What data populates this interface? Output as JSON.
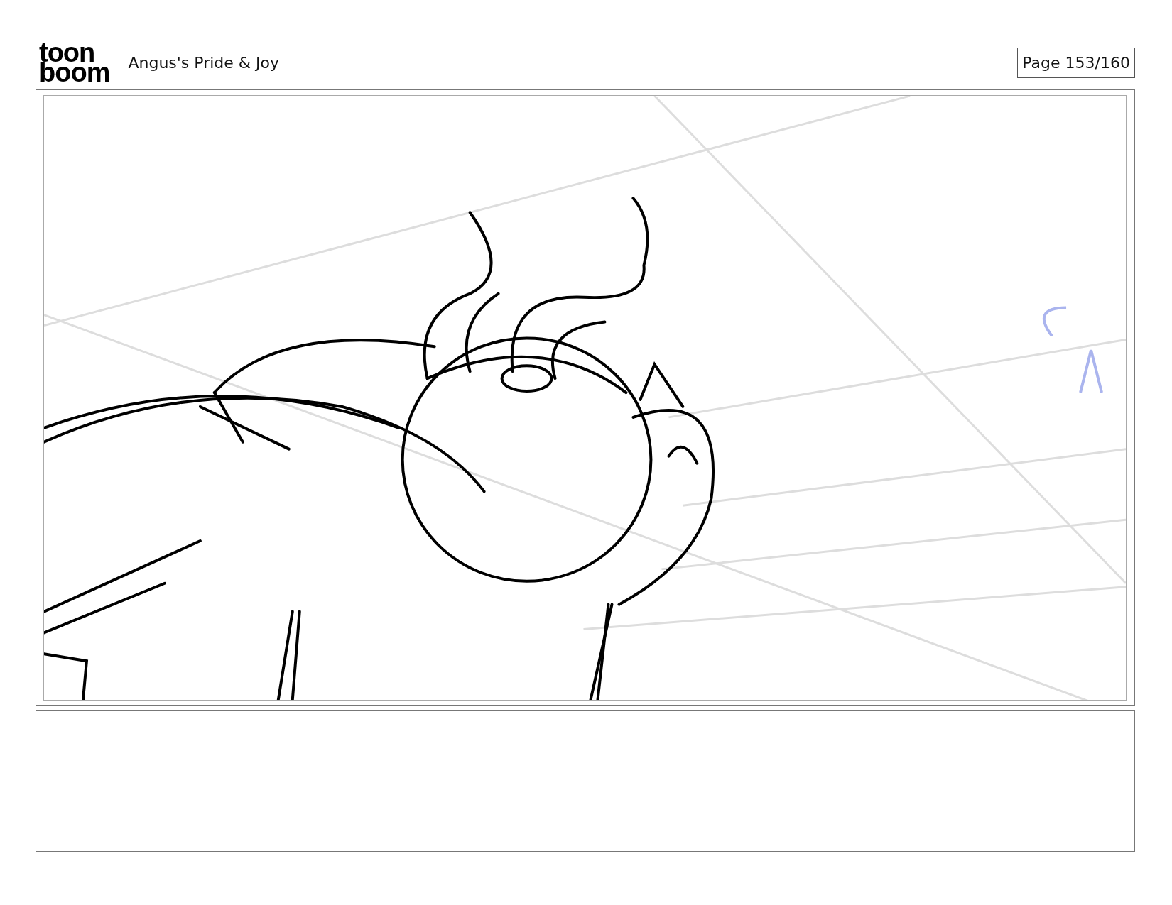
{
  "logo": {
    "lines": [
      "toon",
      "boom"
    ]
  },
  "header": {
    "title": "Angus's Pride & Joy",
    "page": "Page 153/160"
  },
  "panel": {
    "kind": "sketch"
  }
}
